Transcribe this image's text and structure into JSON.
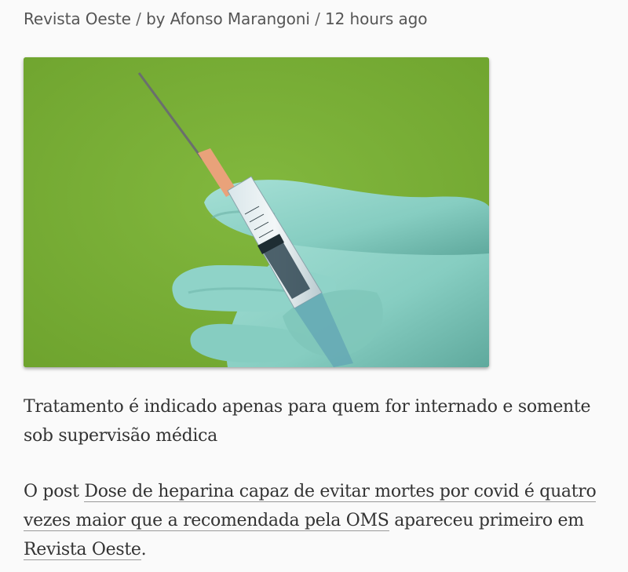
{
  "meta": {
    "source": "Revista Oeste",
    "separator": "/",
    "byline": "by Afonso Marangoni",
    "time": "12 hours ago"
  },
  "hero_image": {
    "subject": "gloved-hand-holding-syringe",
    "background_color": "#7ab036",
    "glove_color": "#8fd3c8"
  },
  "excerpt": "Tratamento é indicado apenas para quem for internado e somente sob supervisão médica",
  "footer": {
    "prefix": "O post ",
    "post_link": "Dose de heparina capaz de evitar mortes por covid é quatro vezes maior que a recomendada pela OMS",
    "middle": " apareceu primeiro em ",
    "site_link": "Revista Oeste",
    "suffix": "."
  }
}
